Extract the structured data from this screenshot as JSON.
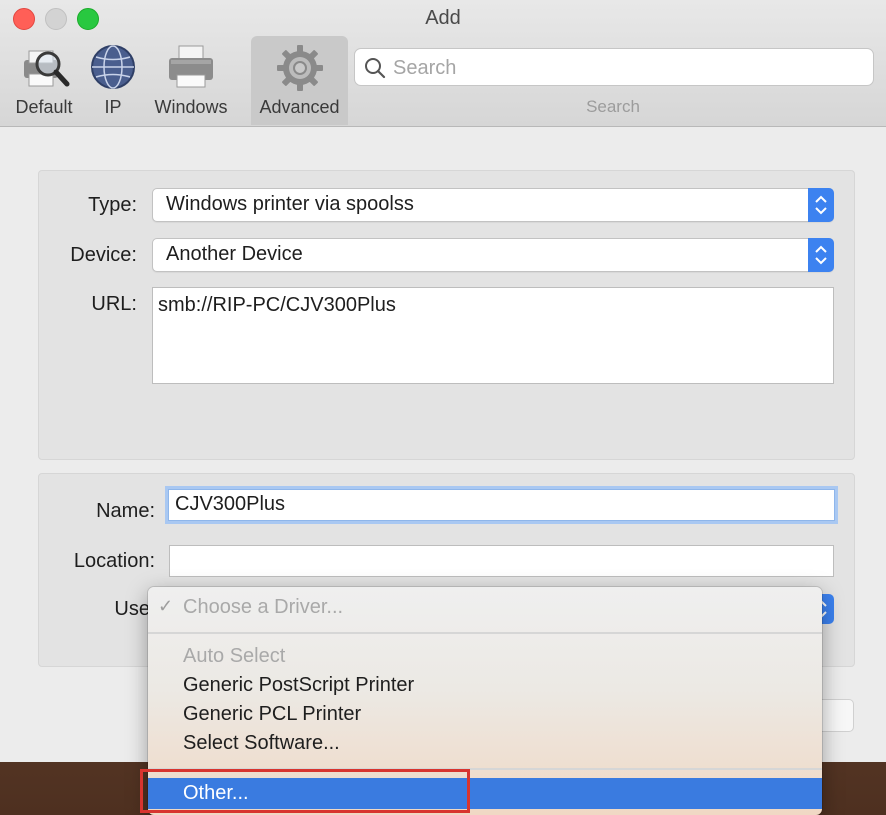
{
  "window": {
    "title": "Add"
  },
  "toolbar": {
    "items": [
      {
        "label": "Default",
        "icon": "default-printer-icon"
      },
      {
        "label": "IP",
        "icon": "globe-icon"
      },
      {
        "label": "Windows",
        "icon": "windows-printer-icon"
      },
      {
        "label": "Advanced",
        "icon": "gear-icon",
        "active": true
      }
    ],
    "search": {
      "placeholder": "Search",
      "caption": "Search"
    }
  },
  "form": {
    "type": {
      "label": "Type:",
      "value": "Windows printer via spoolss"
    },
    "device": {
      "label": "Device:",
      "value": "Another Device"
    },
    "url": {
      "label": "URL:",
      "value": "smb://RIP-PC/CJV300Plus"
    },
    "name": {
      "label": "Name:",
      "value": "CJV300Plus"
    },
    "location": {
      "label": "Location:",
      "value": ""
    },
    "use": {
      "label": "Use"
    }
  },
  "driver_menu": {
    "selected_header": "Choose a Driver...",
    "items": [
      {
        "label": "Auto Select",
        "enabled": false
      },
      {
        "label": "Generic PostScript Printer",
        "enabled": true
      },
      {
        "label": "Generic PCL Printer",
        "enabled": true
      },
      {
        "label": "Select Software...",
        "enabled": true
      }
    ],
    "highlighted": "Other..."
  },
  "colors": {
    "accent": "#3a7be0",
    "highlight_box": "#d8352f",
    "close": "#ff5f57",
    "zoom": "#28c840"
  }
}
